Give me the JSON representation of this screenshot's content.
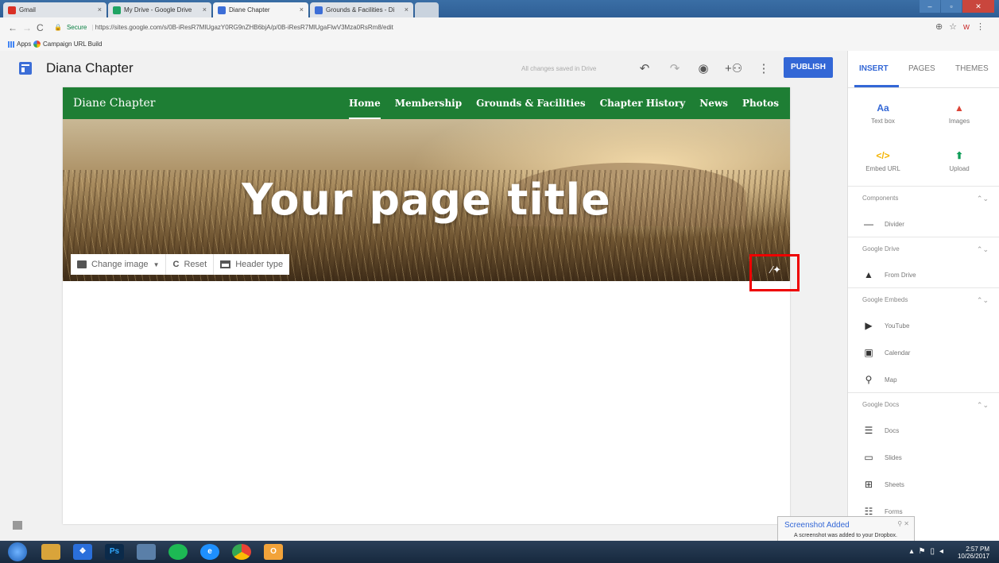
{
  "browser": {
    "tabs": [
      {
        "label": "Gmail",
        "favicon_color": "#d93025",
        "active": false
      },
      {
        "label": "My Drive - Google Drive",
        "favicon_color": "#1fa463",
        "active": false
      },
      {
        "label": "Diane Chapter",
        "favicon_color": "#3c6ed7",
        "active": true
      },
      {
        "label": "Grounds & Facilities - Di",
        "favicon_color": "#3c6ed7",
        "active": false
      }
    ],
    "security_label": "Secure",
    "url": "https://sites.google.com/s/0B-iResR7MlUgazY0RG9nZHB6bjA/p/0B-iResR7MlUgaFlwV3Mza0RsRm8/edit",
    "bookmarks": [
      {
        "label": "Apps",
        "icon": "apps-grid-icon"
      },
      {
        "label": "Campaign URL Build",
        "icon": "campaign-icon"
      }
    ]
  },
  "app": {
    "title": "Diana Chapter",
    "save_status": "All changes saved in Drive",
    "publish_label": "PUBLISH",
    "toolbar_icons": [
      "undo-icon",
      "redo-icon",
      "preview-eye-icon",
      "share-add-person-icon",
      "more-vert-icon"
    ]
  },
  "site": {
    "name": "Diane Chapter",
    "nav": [
      "Home",
      "Membership",
      "Grounds & Facilities",
      "Chapter History",
      "News",
      "Photos"
    ],
    "current_nav": "Home",
    "page_title": "Your page title",
    "hero_tools": {
      "change_image": "Change image",
      "reset": "Reset",
      "header_type": "Header type"
    }
  },
  "panel": {
    "tabs": [
      "INSERT",
      "PAGES",
      "THEMES"
    ],
    "active_tab": "INSERT",
    "quick_tiles": [
      {
        "glyph": "Aa",
        "label": "Text box",
        "color": "#3367d6"
      },
      {
        "glyph": "▲",
        "label": "Images",
        "color": "#db4437"
      },
      {
        "glyph": "</>",
        "label": "Embed URL",
        "color": "#f4b400"
      },
      {
        "glyph": "⬆",
        "label": "Upload",
        "color": "#0f9d58"
      }
    ],
    "sections": [
      {
        "title": "Components",
        "items": [
          {
            "label": "Divider",
            "icon": "divider-icon"
          }
        ]
      },
      {
        "title": "Google Drive",
        "items": [
          {
            "label": "From Drive",
            "icon": "drive-icon"
          }
        ]
      },
      {
        "title": "Google Embeds",
        "items": [
          {
            "label": "YouTube",
            "icon": "youtube-icon"
          },
          {
            "label": "Calendar",
            "icon": "calendar-icon"
          },
          {
            "label": "Map",
            "icon": "map-pin-icon"
          }
        ]
      },
      {
        "title": "Google Docs",
        "items": [
          {
            "label": "Docs",
            "icon": "docs-icon"
          },
          {
            "label": "Slides",
            "icon": "slides-icon"
          },
          {
            "label": "Sheets",
            "icon": "sheets-icon"
          },
          {
            "label": "Forms",
            "icon": "forms-icon"
          }
        ]
      }
    ]
  },
  "notification": {
    "title": "Screenshot Added",
    "body": "A screenshot was added to your Dropbox."
  },
  "taskbar": {
    "time": "2:57 PM",
    "date": "10/26/2017",
    "apps": [
      "windows-explorer-icon",
      "dropbox-icon",
      "photoshop-icon",
      "file-icon",
      "spotify-icon",
      "internet-explorer-icon",
      "chrome-icon",
      "outlook-icon"
    ]
  }
}
